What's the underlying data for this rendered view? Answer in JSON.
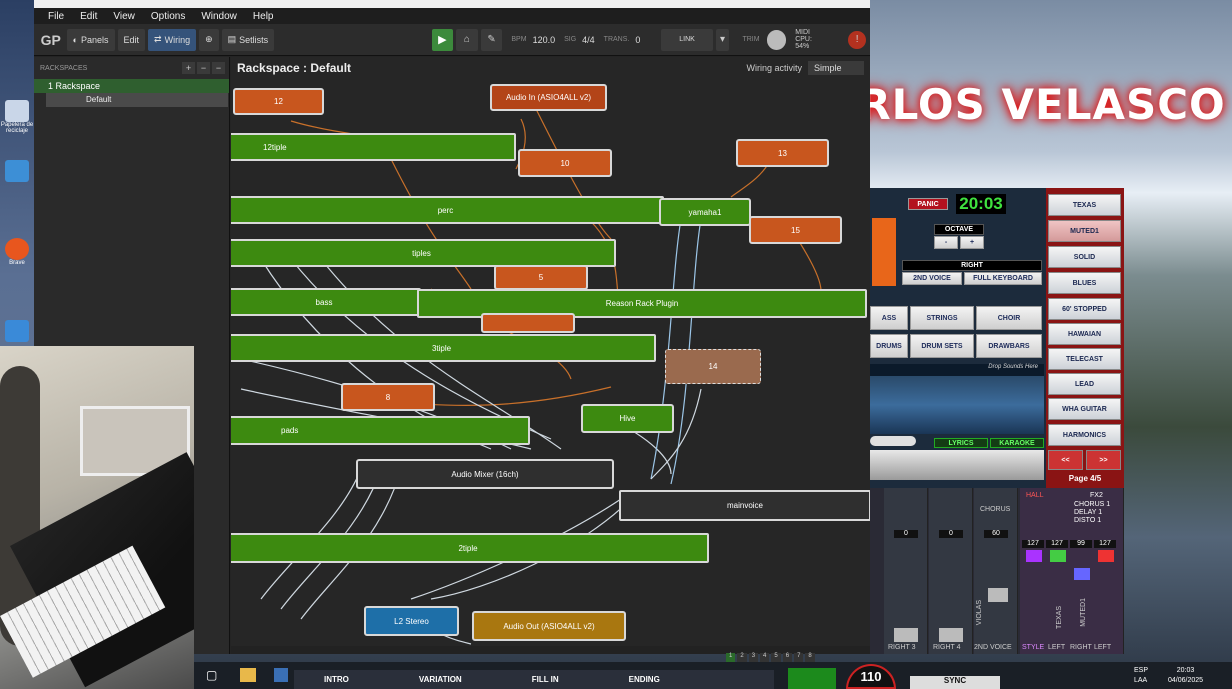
{
  "menu": [
    "File",
    "Edit",
    "View",
    "Options",
    "Window",
    "Help"
  ],
  "toolbar": {
    "panels": "Panels",
    "edit": "Edit",
    "wiring": "Wiring",
    "setlists": "Setlists",
    "bpm_label": "BPM",
    "bpm": "120.0",
    "sig_label": "SIG",
    "sig": "4/4",
    "trans_label": "TRANS.",
    "trans": "0",
    "link": "LINK",
    "trim": "TRIM",
    "midi": "MIDI",
    "cpu_label": "CPU:",
    "cpu": "54%"
  },
  "sidebar": {
    "title": "RACKSPACES",
    "rackspace": "1  Rackspace",
    "variation": "Default"
  },
  "wiring": {
    "title": "Rackspace : Default",
    "activity_label": "Wiring activity",
    "activity": "Simple"
  },
  "nodes": {
    "n12": "12",
    "audioin": "Audio In (ASIO4ALL v2)",
    "n12tiple": "12tiple",
    "n10": "10",
    "n13": "13",
    "perc": "perc",
    "yamaha1": "yamaha1",
    "n15": "15",
    "tiples": "tiples",
    "n5": "5",
    "bass": "bass",
    "reason": "Reason Rack Plugin",
    "n3tiple": "3tiple",
    "n14": "14",
    "n8": "8",
    "hive": "Hive",
    "pads": "pads",
    "mixer": "Audio Mixer (16ch)",
    "mainvoice": "mainvoice",
    "n2tiple": "2tiple",
    "l2": "L2 Stereo",
    "audioout": "Audio Out (ASIO4ALL v2)"
  },
  "overlay": {
    "name": "CARLOS VELASCO"
  },
  "arranger": {
    "panic": "PANIC",
    "time": "20:03",
    "octave": "OCTAVE",
    "minus": "-",
    "plus": "+",
    "right": "RIGHT",
    "second_voice": "2ND VOICE",
    "full_keyboard": "FULL KEYBOARD",
    "ass": "ASS",
    "strings": "STRINGS",
    "choir": "CHOIR",
    "drums": "DRUMS",
    "drum_sets": "DRUM SETS",
    "drawbars": "DRAWBARS",
    "drop": "Drop Sounds Here",
    "lyrics": "LYRICS",
    "karaoke": "KARAOKE"
  },
  "styles": [
    "TEXAS",
    "MUTED1",
    "SOLID",
    "BLUES",
    "60' STOPPED",
    "HAWAIAN",
    "TELECAST",
    "LEAD",
    "WHA GUITAR",
    "HARMONICS"
  ],
  "styles_nav": {
    "prev": "<<",
    "next": ">>",
    "page": "Page 4/5"
  },
  "mixer": {
    "vals": [
      "0",
      "0",
      "60",
      "127",
      "127",
      "99",
      "127"
    ],
    "labels": [
      "RIGHT 3",
      "RIGHT 4",
      "2ND VOICE",
      "STYLE",
      "LEFT",
      "RIGHT",
      "LEFT"
    ],
    "chorus": "CHORUS",
    "fx2": "FX2",
    "fx2_items": [
      "CHORUS 1",
      "DELAY 1",
      "DISTO 1"
    ],
    "fx_name": "HALL",
    "strip_names": [
      "VIOLAS",
      "TEXAS",
      "MUTED1"
    ]
  },
  "bottom": {
    "intro": "INTRO",
    "variation": "VARIATION",
    "fill": "FILL IN",
    "ending": "ENDING",
    "tempo": "110",
    "sync": "SYNC",
    "pages": [
      "1",
      "2",
      "3",
      "4",
      "5",
      "6",
      "7",
      "8"
    ]
  },
  "tray": {
    "lang": "ESP",
    "layout": "LAA",
    "time": "20:03",
    "date": "04/06/2025"
  },
  "desktop": {
    "icons": [
      "Papelera de reciclaje",
      "Brave"
    ]
  }
}
